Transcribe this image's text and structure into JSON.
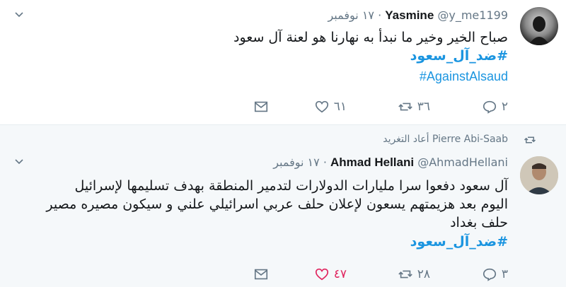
{
  "tweets": [
    {
      "name": "Yasmine",
      "handle": "@y_me1199",
      "dot": "·",
      "date": "١٧ نوفمبر",
      "lines": [
        "صباح الخير وخير ما نبدأ به نهارنا هو لعنة آل سعود"
      ],
      "hashtags": [
        "#ضد_آل_سعود"
      ],
      "hashtags_en": [
        "#AgainstAlsaud"
      ],
      "replies": "٢",
      "retweets": "٣٦",
      "likes": "٦١",
      "liked": false
    },
    {
      "retweeted_by": "Pierre Abi-Saab أعاد التغريد",
      "name": "Ahmad Hellani",
      "handle": "@AhmadHellani",
      "dot": "·",
      "date": "١٧ نوفمبر",
      "lines": [
        "آل سعود دفعوا سرا مليارات الدولارات لتدمير المنطقة بهدف تسليمها لإسرائيل",
        "اليوم بعد هزيمتهم يسعون لإعلان حلف عربي اسرائيلي علني و سيكون مصيره مصير",
        "حلف بغداد"
      ],
      "hashtags": [
        "#ضد_آل_سعود"
      ],
      "replies": "٣",
      "retweets": "٢٨",
      "likes": "٤٧",
      "liked": true
    }
  ],
  "colors": {
    "link": "#1b95e0",
    "muted": "#657786",
    "like_active": "#e0245e"
  }
}
